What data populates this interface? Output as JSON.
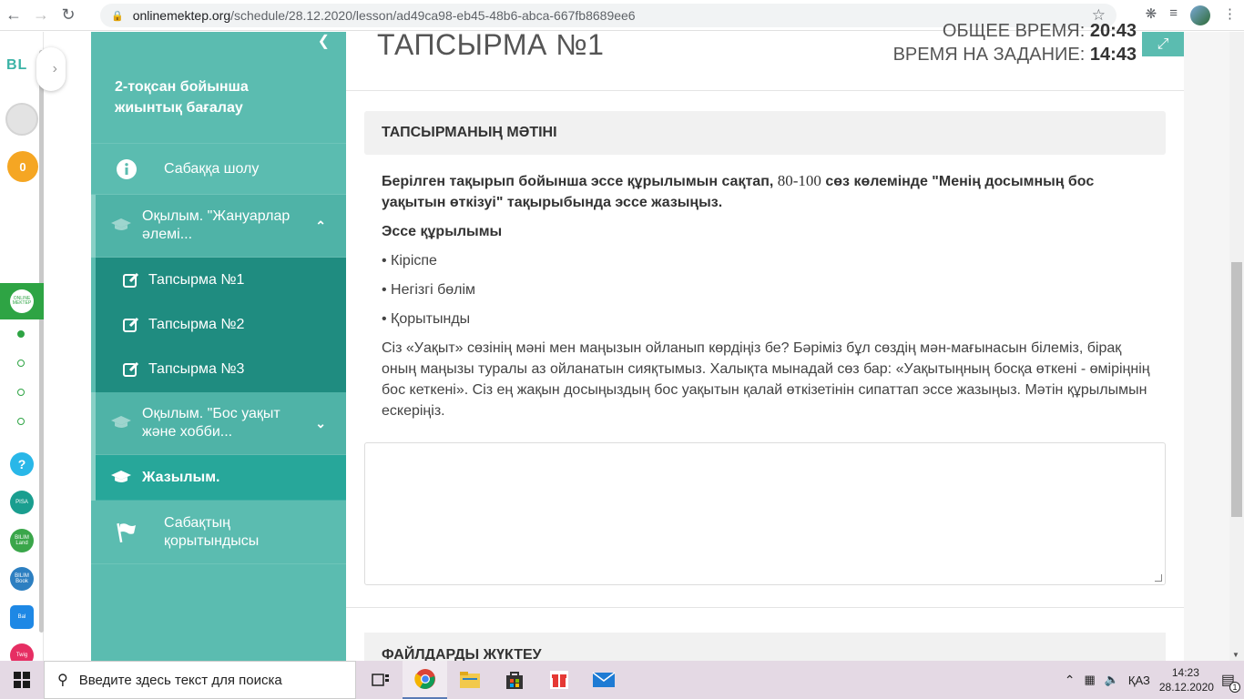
{
  "browser": {
    "url_host": "onlinemektep.org",
    "url_path": "/schedule/28.12.2020/lesson/ad49ca98-eb45-48b6-abca-667fb8689ee6"
  },
  "rail": {
    "logo": "BL",
    "coins": "0",
    "apps": [
      "?",
      "PISA",
      "BILIM Land",
      "BILIM Book",
      "Bal",
      "Twig"
    ]
  },
  "sidebar": {
    "title": "2-тоқсан бойынша жиынтық бағалау",
    "overview": "Сабаққа шолу",
    "section1": "Оқылым. \"Жануарлар әлемі...",
    "tasks": [
      "Тапсырма №1",
      "Тапсырма №2",
      "Тапсырма №3"
    ],
    "section2": "Оқылым. \"Бос уақыт және хобби...",
    "section3": "Жазылым.",
    "results": "Сабақтың қорытындысы"
  },
  "main": {
    "title": "ТАПСЫРМА №1",
    "total_time_label": "ОБЩЕЕ ВРЕМЯ:",
    "total_time_value": "20:43",
    "task_time_label": "ВРЕМЯ НА ЗАДАНИЕ:",
    "task_time_value": "14:43",
    "text_header": "ТАПСЫРМАНЫҢ МӘТІНІ",
    "instruction_a": "Берілген тақырып бойынша эссе құрылымын сақтап, ",
    "instruction_b": "80-100",
    "instruction_c": " сөз көлемінде \"Менің досымның бос уақытын өткізуі\" тақырыбында эссе жазыңыз.",
    "structure_title": "Эссе құрылымы",
    "bullets": [
      "• Кіріспе",
      "• Негізгі бөлім",
      "• Қорытынды"
    ],
    "description": "Сіз «Уақыт» сөзінің мәні мен маңызын ойланып көрдіңіз бе? Бәріміз бұл сөздің мән-мағынасын білеміз, бірақ оның маңызы туралы аз ойланатын сияқтымыз. Халықта мынадай сөз бар: «Уақытыңның босқа өткені - өміріңнің бос кеткені». Сіз ең жақын досыңыздың бос уақытын қалай өткізетінін сипаттап эссе жазыңыз. Мәтін құрылымын ескеріңіз.",
    "answer_value": "",
    "files_header": "ФАЙЛДАРДЫ ЖҮКТЕУ"
  },
  "taskbar": {
    "search_placeholder": "Введите здесь текст для поиска",
    "lang": "ҚАЗ",
    "time": "14:23",
    "date": "28.12.2020",
    "notifications": "1"
  },
  "colors": {
    "accent": "#5bbcb0",
    "accent_dark": "#1f8c80",
    "section_active": "#27a79a"
  }
}
